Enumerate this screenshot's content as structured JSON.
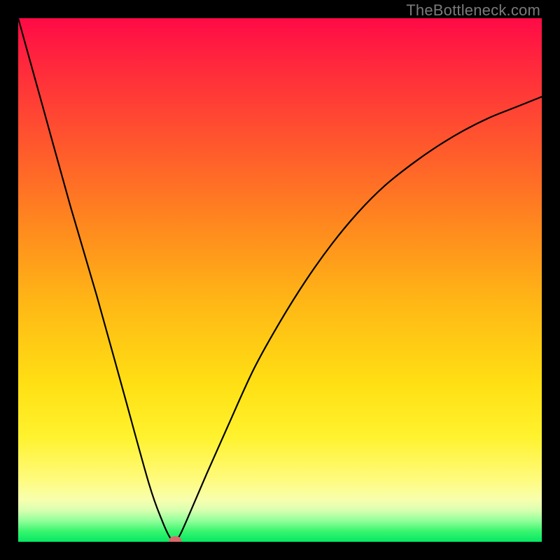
{
  "watermark": "TheBottleneck.com",
  "chart_data": {
    "type": "line",
    "title": "",
    "xlabel": "",
    "ylabel": "",
    "xlim": [
      0,
      100
    ],
    "ylim": [
      0,
      100
    ],
    "series": [
      {
        "name": "left-branch",
        "x": [
          0,
          5,
          10,
          15,
          20,
          25,
          27.5,
          29,
          30
        ],
        "y": [
          100,
          82,
          64,
          47,
          29,
          11,
          4,
          0.8,
          0
        ]
      },
      {
        "name": "right-branch",
        "x": [
          30,
          31,
          33,
          36,
          40,
          45,
          50,
          55,
          60,
          65,
          70,
          75,
          80,
          85,
          90,
          95,
          100
        ],
        "y": [
          0,
          1.5,
          6,
          13,
          22,
          33,
          42,
          50,
          57,
          63,
          68,
          72,
          75.5,
          78.5,
          81,
          83,
          85
        ]
      }
    ],
    "marker": {
      "x": 30,
      "y": 0,
      "color": "#d86a6c",
      "rx": 9,
      "ry": 6
    },
    "gradient_stops": [
      {
        "pct": 0,
        "color": "#ff0a46"
      },
      {
        "pct": 10,
        "color": "#ff2c3b"
      },
      {
        "pct": 25,
        "color": "#ff5a2c"
      },
      {
        "pct": 40,
        "color": "#ff8a1e"
      },
      {
        "pct": 55,
        "color": "#ffb915"
      },
      {
        "pct": 70,
        "color": "#ffe014"
      },
      {
        "pct": 80,
        "color": "#fff22e"
      },
      {
        "pct": 88,
        "color": "#fffb7c"
      },
      {
        "pct": 92,
        "color": "#f7ffae"
      },
      {
        "pct": 94,
        "color": "#d8ffb0"
      },
      {
        "pct": 96,
        "color": "#91ff9a"
      },
      {
        "pct": 98,
        "color": "#38f56e"
      },
      {
        "pct": 100,
        "color": "#05e763"
      }
    ]
  }
}
